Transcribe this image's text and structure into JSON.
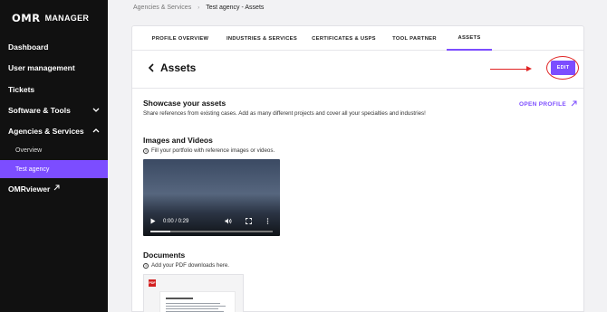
{
  "app": {
    "logo_mark": "OMR",
    "logo_text": "MANAGER"
  },
  "sidebar": {
    "items": [
      {
        "label": "Dashboard"
      },
      {
        "label": "User management"
      },
      {
        "label": "Tickets"
      },
      {
        "label": "Software & Tools",
        "chevron": "chevron-down-icon"
      },
      {
        "label": "Agencies & Services",
        "chevron": "chevron-up-icon"
      },
      {
        "label": "OMRviewer",
        "icon": "external-link-icon"
      }
    ],
    "sub_items": [
      {
        "label": "Overview"
      },
      {
        "label": "Test agency",
        "active": true
      }
    ]
  },
  "breadcrumb": {
    "parent": "Agencies & Services",
    "current": "Test agency - Assets"
  },
  "tabs": [
    {
      "label": "PROFILE OVERVIEW"
    },
    {
      "label": "INDUSTRIES & SERVICES"
    },
    {
      "label": "CERTIFICATES & USPS"
    },
    {
      "label": "TOOL PARTNER"
    },
    {
      "label": "ASSETS",
      "active": true
    }
  ],
  "page": {
    "title": "Assets",
    "edit_label": "EDIT",
    "open_profile_label": "OPEN PROFILE"
  },
  "showcase": {
    "title": "Showcase your assets",
    "description": "Share references from existing cases. Add as many different projects and cover all your specialties and industries!"
  },
  "images_videos": {
    "title": "Images and Videos",
    "hint": "Fill your portfolio with reference images or videos.",
    "video_time": "0:00 / 0:29",
    "video_progress": 0.16
  },
  "documents": {
    "title": "Documents",
    "hint": "Add your PDF downloads here.",
    "pdf_badge": "PDF"
  },
  "colors": {
    "accent": "#7c4dff",
    "sidebar_bg": "#111111",
    "annotation_red": "#e02424"
  }
}
